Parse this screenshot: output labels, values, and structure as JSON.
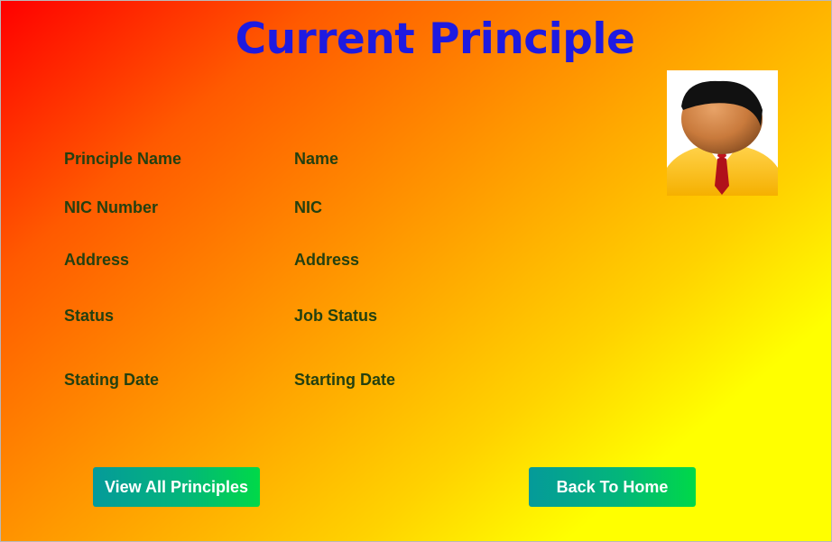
{
  "title": "Current Principle",
  "fields": [
    {
      "label": "Principle Name",
      "value": "Name"
    },
    {
      "label": "NIC Number",
      "value": "NIC"
    },
    {
      "label": "Address",
      "value": "Address"
    },
    {
      "label": "Status",
      "value": "Job Status"
    },
    {
      "label": "Stating Date",
      "value": "Starting Date"
    }
  ],
  "avatar": {
    "icon": "person-avatar-icon"
  },
  "buttons": {
    "view_all": "View All Principles",
    "back_home": "Back To Home"
  },
  "colors": {
    "title": "#1e1ae0",
    "label_text": "#234010",
    "button_start": "#059a9a",
    "button_end": "#00d948",
    "gradient_start": "#ff0000",
    "gradient_end": "#ffff00"
  }
}
